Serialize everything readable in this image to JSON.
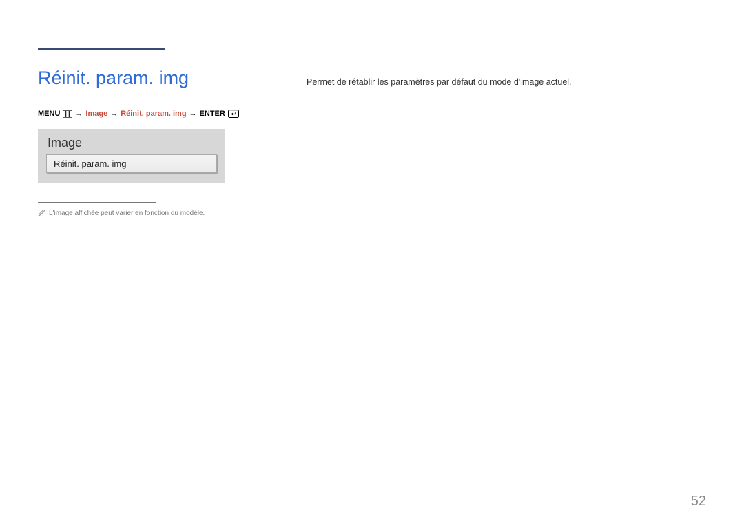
{
  "title": "Réinit. param. img",
  "breadcrumb": {
    "menu": "MENU",
    "arrow": "→",
    "image": "Image",
    "reset": "Réinit. param. img",
    "enter": "ENTER"
  },
  "preview": {
    "header": "Image",
    "item": "Réinit. param. img"
  },
  "note": "L'image affichée peut varier en fonction du modèle.",
  "description": "Permet de rétablir les paramètres par défaut du mode d'image actuel.",
  "page_number": "52"
}
